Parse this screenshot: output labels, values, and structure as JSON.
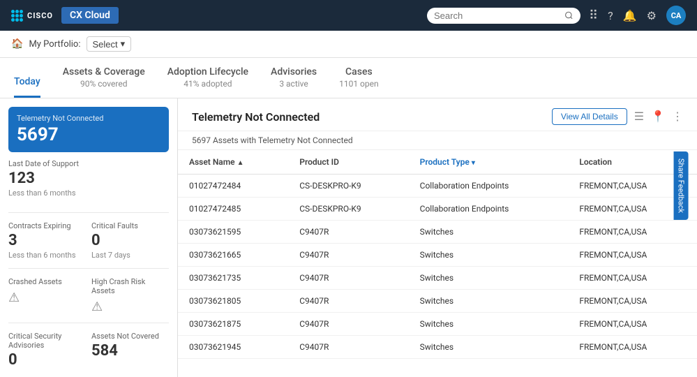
{
  "topNav": {
    "appTitle": "CX Cloud",
    "search": {
      "placeholder": "Search"
    },
    "avatar": "CA"
  },
  "portfolio": {
    "label": "My Portfolio:",
    "selectLabel": "Select"
  },
  "tabs": [
    {
      "id": "today",
      "label": "Today",
      "sub": "",
      "active": true
    },
    {
      "id": "assets",
      "label": "Assets & Coverage",
      "sub": "90% covered",
      "active": false
    },
    {
      "id": "adoption",
      "label": "Adoption Lifecycle",
      "sub": "41% adopted",
      "active": false
    },
    {
      "id": "advisories",
      "label": "Advisories",
      "sub": "3 active",
      "active": false
    },
    {
      "id": "cases",
      "label": "Cases",
      "sub": "1101 open",
      "active": false
    }
  ],
  "sidebar": {
    "telemetry": {
      "title": "Telemetry Not Connected",
      "value": "5697",
      "sub": ""
    },
    "lastSupport": {
      "title": "Last Date of Support",
      "value": "123",
      "sub": "Less than 6 months"
    },
    "contractsExpiring": {
      "title": "Contracts Expiring",
      "value": "3",
      "sub": "Less than 6 months"
    },
    "criticalFaults": {
      "title": "Critical Faults",
      "value": "0",
      "sub": "Last 7 days"
    },
    "crashedAssets": {
      "title": "Crashed Assets",
      "icon": "⚠"
    },
    "highCrashRisk": {
      "title": "High Crash Risk Assets",
      "icon": "⚠"
    },
    "criticalSecurity": {
      "title": "Critical Security Advisories",
      "value": "0"
    },
    "assetsNotCovered": {
      "title": "Assets Not Covered",
      "value": "584"
    }
  },
  "panel": {
    "title": "Telemetry Not Connected",
    "viewAllLabel": "View All Details",
    "subText": "5697 Assets with Telemetry Not Connected",
    "columns": [
      {
        "id": "asset",
        "label": "Asset Name",
        "sortable": true,
        "sortDir": "asc"
      },
      {
        "id": "product",
        "label": "Product ID",
        "sortable": false
      },
      {
        "id": "type",
        "label": "Product Type",
        "sortable": true,
        "active": true,
        "sortDir": "desc"
      },
      {
        "id": "location",
        "label": "Location",
        "sortable": false
      }
    ],
    "rows": [
      {
        "asset": "01027472484",
        "product": "CS-DESKPRO-K9",
        "type": "Collaboration Endpoints",
        "location": "FREMONT,CA,USA"
      },
      {
        "asset": "01027472485",
        "product": "CS-DESKPRO-K9",
        "type": "Collaboration Endpoints",
        "location": "FREMONT,CA,USA"
      },
      {
        "asset": "03073621595",
        "product": "C9407R",
        "type": "Switches",
        "location": "FREMONT,CA,USA"
      },
      {
        "asset": "03073621665",
        "product": "C9407R",
        "type": "Switches",
        "location": "FREMONT,CA,USA"
      },
      {
        "asset": "03073621735",
        "product": "C9407R",
        "type": "Switches",
        "location": "FREMONT,CA,USA"
      },
      {
        "asset": "03073621805",
        "product": "C9407R",
        "type": "Switches",
        "location": "FREMONT,CA,USA"
      },
      {
        "asset": "03073621875",
        "product": "C9407R",
        "type": "Switches",
        "location": "FREMONT,CA,USA"
      },
      {
        "asset": "03073621945",
        "product": "C9407R",
        "type": "Switches",
        "location": "FREMONT,CA,USA"
      }
    ]
  },
  "feedback": "Share Feedback"
}
